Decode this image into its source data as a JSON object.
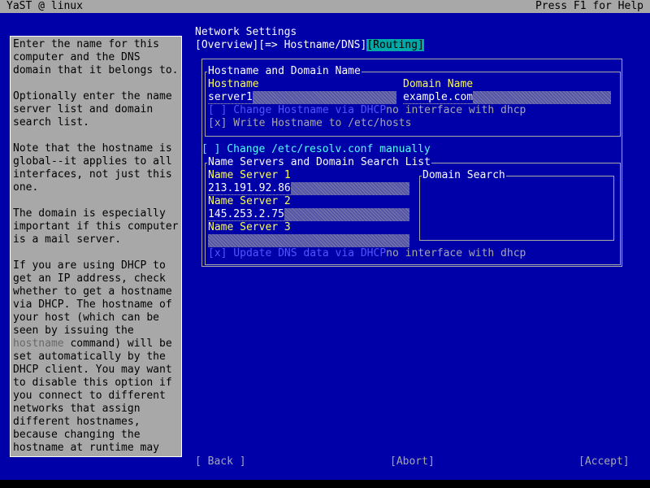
{
  "titlebar": {
    "left": "YaST @ linux",
    "right": "Press F1 for Help"
  },
  "help": {
    "paragraphs": [
      "Enter the name for this computer and the DNS domain that it belongs to.",
      "Optionally enter the name server list and domain search list.",
      "Note that the hostname is global--it applies to all interfaces, not just this one.",
      "The domain is especially important if this computer is a mail server."
    ],
    "dhcp_before": "If you are using DHCP to get an IP address, check whether to get a hostname via DHCP. The hostname of your host (which can be seen by issuing the ",
    "dhcp_cmd": "hostname",
    "dhcp_after": " command) will be set automatically by the DHCP client. You may want to disable this option if you connect to different networks that assign different hostnames, because changing the hostname at runtime may"
  },
  "dialog": {
    "title": "Network Settings",
    "tabs": [
      "[Overview]",
      "[=> Hostname/DNS]",
      "[Routing]"
    ]
  },
  "hostname_frame": {
    "legend": "Hostname and Domain Name",
    "hostname_label": "Hostname",
    "hostname_value": "server1",
    "domain_label": "Domain Name",
    "domain_value": "example.com",
    "change_dhcp": "[ ] Change Hostname via DHCP",
    "change_dhcp_note": "no interface with dhcp",
    "write_hosts": "[x] Write Hostname to /etc/hosts"
  },
  "resolv_manual": "[ ] Change /etc/resolv.conf manually",
  "dns_frame": {
    "legend": "Name Servers and Domain Search List",
    "ns1_label": "Name Server 1",
    "ns1_value": "213.191.92.86",
    "ns2_label": "Name Server 2",
    "ns2_value": "145.253.2.75",
    "ns3_label": "Name Server 3",
    "ns3_value": "",
    "domain_search_label": "Domain Search",
    "update_dns": "[x] Update DNS data via DHCP",
    "update_dns_note": "no interface with dhcp"
  },
  "buttons": {
    "back": "[ Back ]",
    "abort": "[Abort]",
    "accept": "[Accept]"
  },
  "colors": {
    "background": "#0000a8",
    "panel": "#a8a8a8",
    "accent": "#fcfc54",
    "focus": "#00a8a8"
  }
}
